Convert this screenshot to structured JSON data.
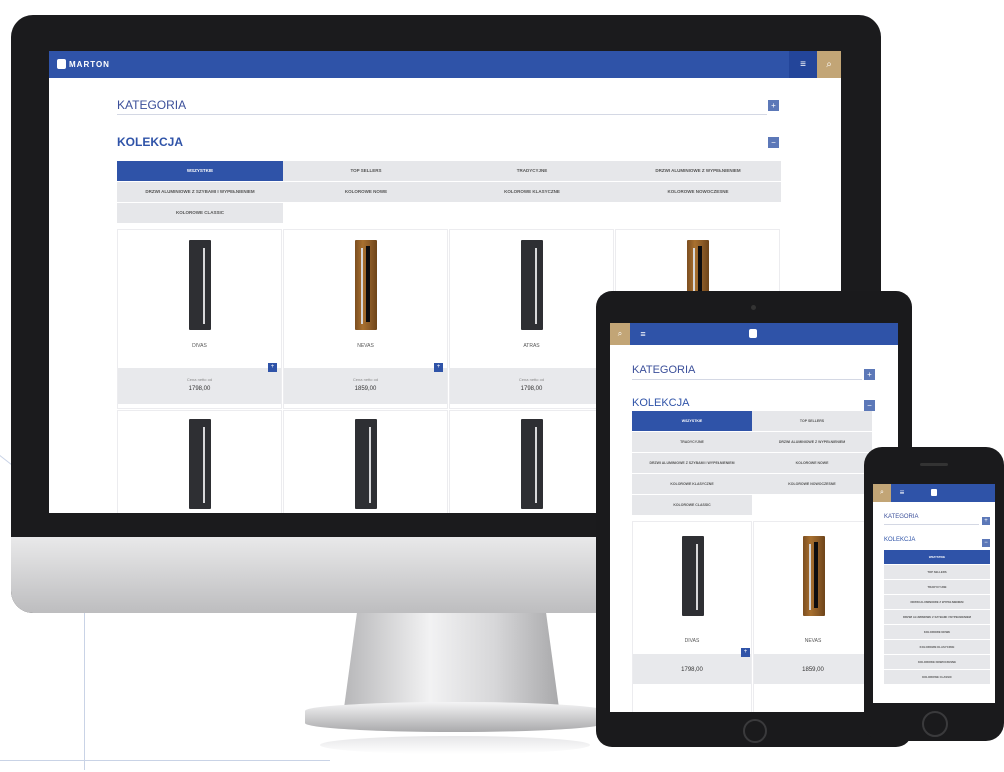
{
  "brand": {
    "logo_text": "MARTON",
    "accent": "#2f53a8",
    "gold": "#c2a576"
  },
  "desktop": {
    "menu_icon": "hamburger-icon",
    "category_title": "KATEGORIA",
    "collection_title": "KOLEKCJA",
    "tabs": [
      "WSZYSTKIE",
      "TOP SELLERS",
      "TRADYCYJNE",
      "DRZWI ALUMINIOWE Z WYPEŁNIENIEM",
      "DRZWI ALUMINIOWE Z SZYBAMI I WYPEŁNIENIEM",
      "KOLOROWE NOWE",
      "KOLOROWE KLASYCZNE",
      "KOLOROWE NOWOCZESNE",
      "KOLOROWE CLASSIC"
    ],
    "products": [
      {
        "name": "DIVAS",
        "price_label": "Cena netto od",
        "price": "1798,00",
        "style": "dark"
      },
      {
        "name": "NEVAS",
        "price_label": "Cena netto od",
        "price": "1859,00",
        "style": "wood"
      },
      {
        "name": "ATRAS",
        "price_label": "Cena netto od",
        "price": "1798,00",
        "style": "dark"
      },
      {
        "name": "",
        "price_label": "",
        "price": "",
        "style": "wood"
      }
    ]
  },
  "tablet": {
    "category_title": "KATEGORIA",
    "collection_title": "KOLEKCJA",
    "tabs": [
      "WSZYSTKIE",
      "TOP SELLERS",
      "TRADYCYJNE",
      "DRZWI ALUMINIOWE Z WYPEŁNIENIEM",
      "DRZWI ALUMINIOWE Z SZYBAMI I WYPEŁNIENIEM",
      "KOLOROWE NOWE",
      "KOLOROWE KLASYCZNE",
      "KOLOROWE NOWOCZESNE",
      "KOLOROWE CLASSIC"
    ],
    "products": [
      {
        "name": "DIVAS",
        "price": "1798,00",
        "style": "dark"
      },
      {
        "name": "NEVAS",
        "price": "1859,00",
        "style": "wood"
      }
    ]
  },
  "phone": {
    "category_title": "KATEGORIA",
    "collection_title": "KOLEKCJA",
    "tabs": [
      "WSZYSTKIE",
      "TOP SELLERS",
      "TRADYCYJNE",
      "DRZWI ALUMINIOWE Z WYPEŁNIENIEM",
      "DRZWI ALUMINIOWE Z SZYBAMI I WYPEŁNIENIEM",
      "KOLOROWE NOWE",
      "KOLOROWE KLASYCZNE",
      "KOLOROWE NOWOCZESNE",
      "KOLOROWE CLASSIC"
    ]
  }
}
